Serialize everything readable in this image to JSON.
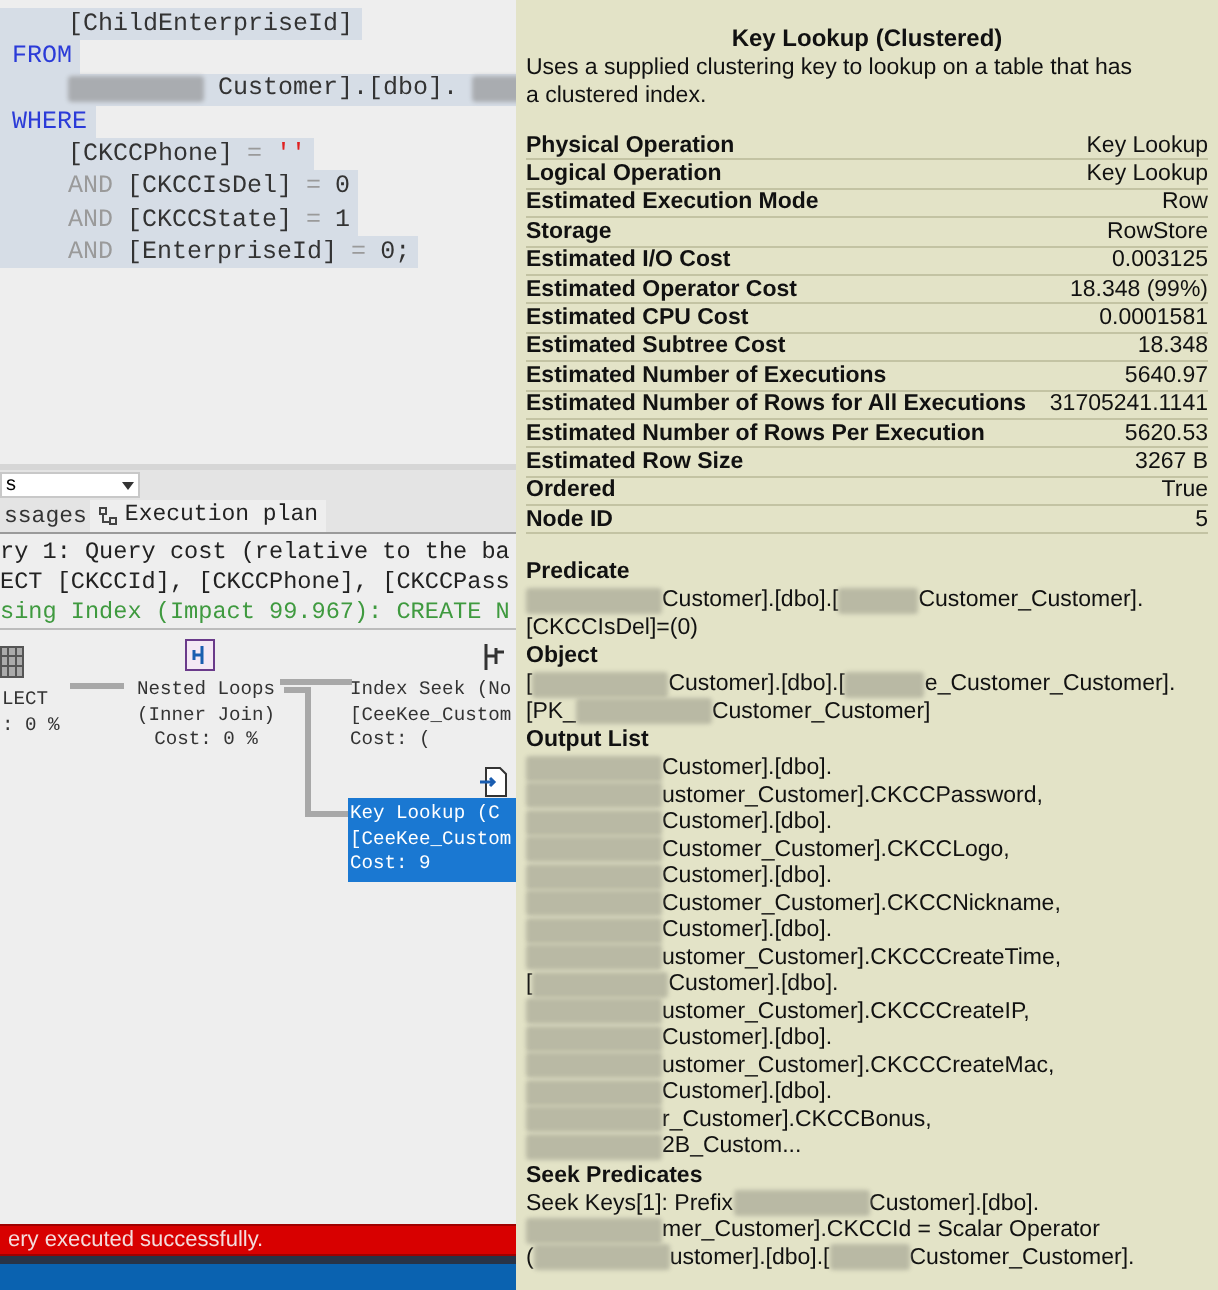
{
  "editor": {
    "lines": [
      [
        {
          "kind": "id",
          "text": "[ChildEnterpriseId]"
        }
      ],
      [
        {
          "kind": "kw",
          "text": "FROM"
        }
      ],
      [
        {
          "kind": "blur"
        },
        {
          "kind": "id",
          "text": "Customer].[dbo]."
        },
        {
          "kind": "blur"
        }
      ],
      [
        {
          "kind": "kw",
          "text": "WHERE"
        }
      ],
      [
        {
          "kind": "id",
          "text": "[CKCCPhone]"
        },
        {
          "kind": "op",
          "text": "="
        },
        {
          "kind": "str",
          "text": "''"
        }
      ],
      [
        {
          "kind": "op",
          "text": "AND"
        },
        {
          "kind": "id",
          "text": "[CKCCIsDel]"
        },
        {
          "kind": "op",
          "text": "="
        },
        {
          "kind": "id",
          "text": "0"
        }
      ],
      [
        {
          "kind": "op",
          "text": "AND"
        },
        {
          "kind": "id",
          "text": "[CKCCState]"
        },
        {
          "kind": "op",
          "text": "="
        },
        {
          "kind": "id",
          "text": "1"
        }
      ],
      [
        {
          "kind": "op",
          "text": "AND"
        },
        {
          "kind": "id",
          "text": "[EnterpriseId]"
        },
        {
          "kind": "op",
          "text": "="
        },
        {
          "kind": "id",
          "text": "0;"
        }
      ]
    ]
  },
  "toolbar": {
    "dropdown": "s"
  },
  "tabs": [
    {
      "label": "ssages",
      "selected": false
    },
    {
      "label": "Execution plan",
      "selected": true
    }
  ],
  "plan": {
    "header": [
      {
        "kind": "plain",
        "text": "ry 1: Query cost (relative to the ba"
      },
      {
        "kind": "plain",
        "text": "ECT [CKCCId], [CKCCPhone], [CKCCPass"
      },
      {
        "kind": "missing",
        "text": "sing Index (Impact 99.967): CREATE N"
      }
    ],
    "nodes": [
      {
        "kind": "select",
        "selected": false,
        "lines": [
          "LECT",
          ": 0 %"
        ]
      },
      {
        "kind": "loops",
        "selected": false,
        "lines": [
          "Nested Loops",
          "(Inner Join)",
          "Cost: 0 %"
        ]
      },
      {
        "kind": "seek",
        "selected": false,
        "lines": [
          "Index Seek (No",
          "[CeeKee_Custom",
          "Cost: ("
        ]
      },
      {
        "kind": "lookup",
        "selected": true,
        "lines": [
          "Key Lookup (C",
          "[CeeKee_Custom",
          "Cost: 9"
        ]
      }
    ]
  },
  "status_bar": {
    "message": "ery executed successfully."
  },
  "tooltip": {
    "title": "Key Lookup (Clustered)",
    "description": "Uses a supplied clustering key to lookup on a table that has a clustered index.",
    "properties": [
      {
        "label": "Physical Operation",
        "value": "Key Lookup"
      },
      {
        "label": "Logical Operation",
        "value": "Key Lookup"
      },
      {
        "label": "Estimated Execution Mode",
        "value": "Row"
      },
      {
        "label": "Storage",
        "value": "RowStore"
      },
      {
        "label": "Estimated I/O Cost",
        "value": "0.003125"
      },
      {
        "label": "Estimated Operator Cost",
        "value": "18.348 (99%)"
      },
      {
        "label": "Estimated CPU Cost",
        "value": "0.0001581"
      },
      {
        "label": "Estimated Subtree Cost",
        "value": "18.348"
      },
      {
        "label": "Estimated Number of Executions",
        "value": "5640.97"
      },
      {
        "label": "Estimated Number of Rows for All Executions",
        "value": "31705241.1141"
      },
      {
        "label": "Estimated Number of Rows Per Execution",
        "value": "5620.53"
      },
      {
        "label": "Estimated Row Size",
        "value": "3267 B"
      },
      {
        "label": "Ordered",
        "value": "True"
      },
      {
        "label": "Node ID",
        "value": "5"
      }
    ],
    "sections": [
      {
        "heading": "Predicate",
        "lines": [
          [
            {
              "kind": "blur"
            },
            {
              "kind": "text",
              "text": "Customer].[dbo].["
            },
            {
              "kind": "blur"
            },
            {
              "kind": "text",
              "text": "Customer_Customer]."
            }
          ],
          [
            {
              "kind": "text",
              "text": "[CKCCIsDel]=(0)"
            }
          ]
        ]
      },
      {
        "heading": "Object",
        "lines": [
          [
            {
              "kind": "text",
              "text": "["
            },
            {
              "kind": "blur"
            },
            {
              "kind": "text",
              "text": "Customer].[dbo].["
            },
            {
              "kind": "blur"
            },
            {
              "kind": "text",
              "text": "e_Customer_Customer]."
            }
          ],
          [
            {
              "kind": "text",
              "text": "[PK_"
            },
            {
              "kind": "blur"
            },
            {
              "kind": "text",
              "text": "Customer_Customer]"
            }
          ]
        ]
      },
      {
        "heading": "Output List",
        "lines": [
          [
            {
              "kind": "blur"
            },
            {
              "kind": "text",
              "text": "Customer].[dbo]."
            }
          ],
          [
            {
              "kind": "blur"
            },
            {
              "kind": "text",
              "text": "ustomer_Customer].CKCCPassword,"
            }
          ],
          [
            {
              "kind": "blur"
            },
            {
              "kind": "text",
              "text": "Customer].[dbo]."
            }
          ],
          [
            {
              "kind": "blur"
            },
            {
              "kind": "text",
              "text": "Customer_Customer].CKCCLogo,"
            }
          ],
          [
            {
              "kind": "blur"
            },
            {
              "kind": "text",
              "text": "Customer].[dbo]."
            }
          ],
          [
            {
              "kind": "blur"
            },
            {
              "kind": "text",
              "text": "Customer_Customer].CKCCNickname,"
            }
          ],
          [
            {
              "kind": "blur"
            },
            {
              "kind": "text",
              "text": "Customer].[dbo]."
            }
          ],
          [
            {
              "kind": "blur"
            },
            {
              "kind": "text",
              "text": "ustomer_Customer].CKCCCreateTime,"
            }
          ],
          [
            {
              "kind": "text",
              "text": "["
            },
            {
              "kind": "blur"
            },
            {
              "kind": "text",
              "text": "Customer].[dbo]."
            }
          ],
          [
            {
              "kind": "blur"
            },
            {
              "kind": "text",
              "text": "ustomer_Customer].CKCCCreateIP,"
            }
          ],
          [
            {
              "kind": "blur"
            },
            {
              "kind": "text",
              "text": "Customer].[dbo]."
            }
          ],
          [
            {
              "kind": "blur"
            },
            {
              "kind": "text",
              "text": "ustomer_Customer].CKCCCreateMac,"
            }
          ],
          [
            {
              "kind": "blur"
            },
            {
              "kind": "text",
              "text": "Customer].[dbo]."
            }
          ],
          [
            {
              "kind": "blur"
            },
            {
              "kind": "text",
              "text": "r_Customer].CKCCBonus,"
            }
          ],
          [
            {
              "kind": "blur"
            },
            {
              "kind": "text",
              "text": "2B_Custom..."
            }
          ]
        ]
      },
      {
        "heading": "Seek Predicates",
        "lines": [
          [
            {
              "kind": "text",
              "text": "Seek Keys[1]: Prefix"
            },
            {
              "kind": "blur"
            },
            {
              "kind": "text",
              "text": "Customer].[dbo]."
            }
          ],
          [
            {
              "kind": "blur"
            },
            {
              "kind": "text",
              "text": "mer_Customer].CKCCId = Scalar Operator"
            }
          ],
          [
            {
              "kind": "text",
              "text": "("
            },
            {
              "kind": "blur"
            },
            {
              "kind": "text",
              "text": "ustomer].[dbo].["
            },
            {
              "kind": "blur"
            },
            {
              "kind": "text",
              "text": "Customer_Customer]."
            }
          ]
        ]
      }
    ]
  }
}
